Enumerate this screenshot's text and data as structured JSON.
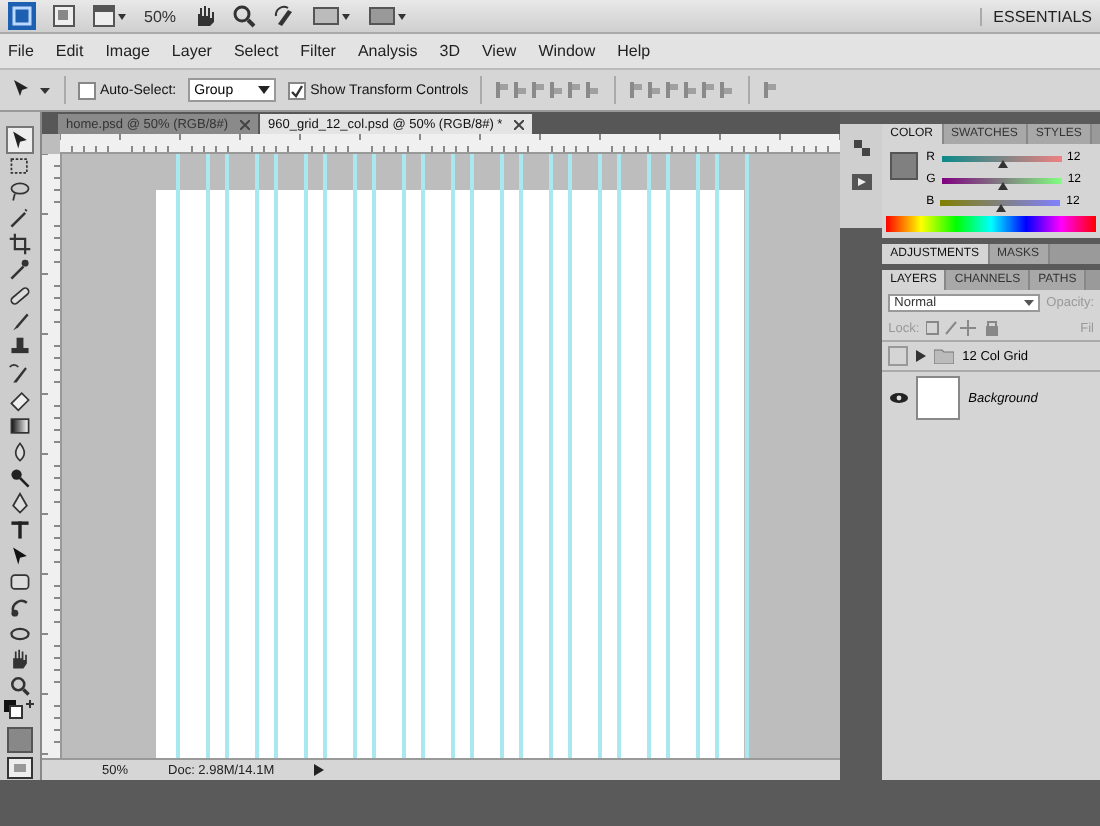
{
  "app_bar": {
    "zoom": "50%",
    "workspace": "ESSENTIALS"
  },
  "menu": [
    "File",
    "Edit",
    "Image",
    "Layer",
    "Select",
    "Filter",
    "Analysis",
    "3D",
    "View",
    "Window",
    "Help"
  ],
  "options_bar": {
    "auto_select": {
      "label": "Auto-Select:",
      "checked": false
    },
    "auto_select_target": "Group",
    "transform_controls": {
      "label": "Show Transform Controls",
      "checked": true
    }
  },
  "document_tabs": [
    {
      "label": "home.psd @ 50% (RGB/8#)",
      "selected": false
    },
    {
      "label": "960_grid_12_col.psd @ 50% (RGB/8#) *",
      "selected": true
    }
  ],
  "status_bar": {
    "zoom": "50%",
    "doc_size": "Doc: 2.98M/14.1M"
  },
  "color_panel": {
    "tabs": [
      {
        "label": "COLOR",
        "selected": true
      },
      {
        "label": "SWATCHES",
        "selected": false
      },
      {
        "label": "STYLES",
        "selected": false
      }
    ],
    "sliders": [
      {
        "label": "R",
        "level": 0.5,
        "value": "12"
      },
      {
        "label": "G",
        "level": 0.5,
        "value": "12"
      },
      {
        "label": "B",
        "level": 0.5,
        "value": "12"
      }
    ]
  },
  "adjustments_panel": {
    "tabs": [
      {
        "label": "ADJUSTMENTS",
        "selected": true
      },
      {
        "label": "MASKS",
        "selected": false
      }
    ]
  },
  "layers_panel": {
    "tabs": [
      {
        "label": "LAYERS",
        "selected": true
      },
      {
        "label": "CHANNELS",
        "selected": false
      },
      {
        "label": "PATHS",
        "selected": false
      }
    ],
    "blend_mode": "Normal",
    "opacity_label": "Opacity:",
    "lock_label": "Lock:",
    "fill_label": "Fil",
    "layers": [
      {
        "kind": "group",
        "name": "12 Col Grid",
        "visible": false,
        "expanded": false
      },
      {
        "kind": "layer",
        "name": "Background",
        "visible": true
      }
    ]
  }
}
